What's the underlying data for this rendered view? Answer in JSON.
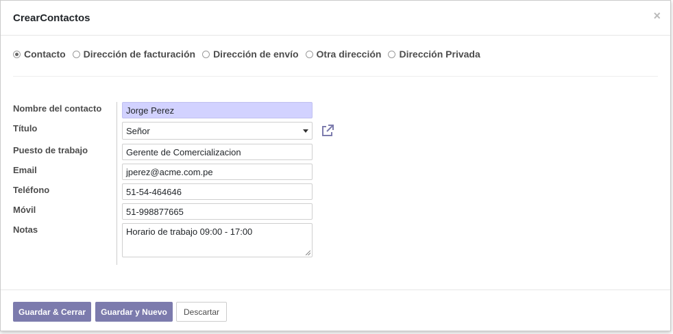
{
  "modal": {
    "title": "CrearContactos",
    "close_glyph": "×"
  },
  "address_types": [
    {
      "label": "Contacto",
      "checked": true
    },
    {
      "label": "Dirección de facturación",
      "checked": false
    },
    {
      "label": "Dirección de envío",
      "checked": false
    },
    {
      "label": "Otra dirección",
      "checked": false
    },
    {
      "label": "Dirección Privada",
      "checked": false
    }
  ],
  "form": {
    "labels": {
      "name": "Nombre del contacto",
      "title": "Título",
      "job": "Puesto de trabajo",
      "email": "Email",
      "phone": "Teléfono",
      "mobile": "Móvil",
      "notes": "Notas"
    },
    "values": {
      "name": "Jorge Perez",
      "title": "Señor",
      "job": "Gerente de Comercializacion",
      "email": "jperez@acme.com.pe",
      "phone": "51-54-464646",
      "mobile": "51-998877665",
      "notes": "Horario de trabajo 09:00 - 17:00"
    },
    "external_link_icon": "external-link-icon"
  },
  "footer": {
    "save_close": "Guardar & Cerrar",
    "save_new": "Guardar y Nuevo",
    "discard": "Descartar"
  },
  "colors": {
    "primary": "#7c7bad",
    "required_field": "#d2d2ff"
  }
}
